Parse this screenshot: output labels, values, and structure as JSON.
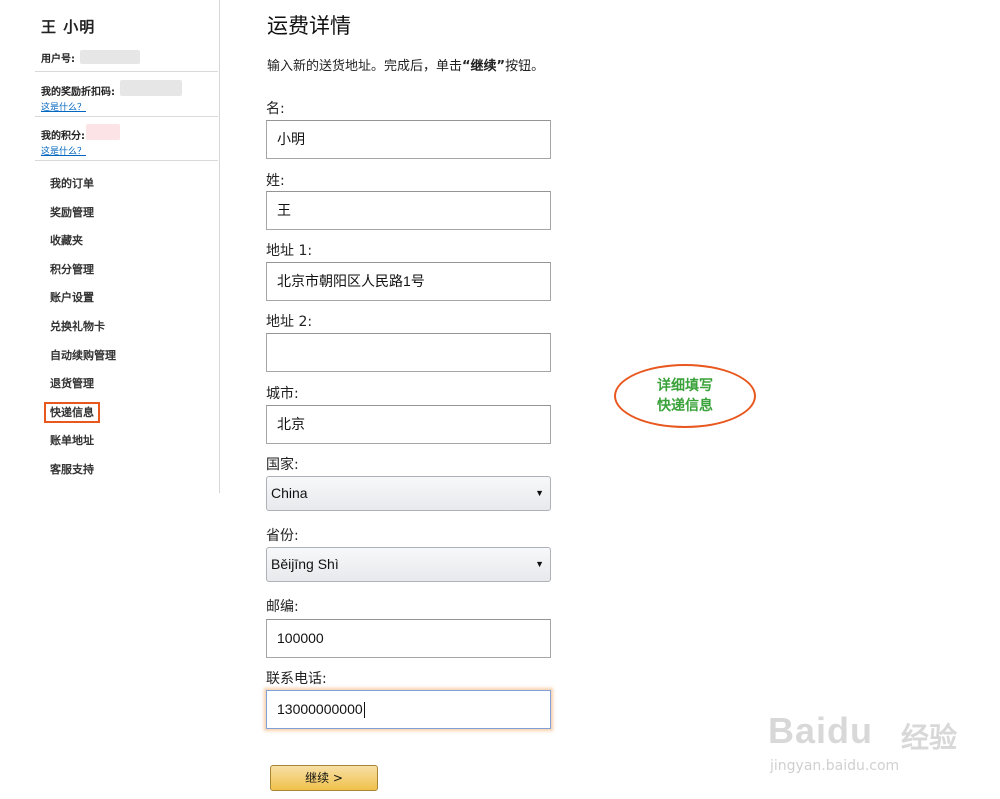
{
  "sidebar": {
    "user_name": "王 小明",
    "user_id_label": "用户号:",
    "reward_code_label": "我的奖励折扣码:",
    "reward_code_link": "这是什么？",
    "points_label": "我的积分:",
    "points_link": "这是什么？",
    "menu": [
      {
        "label": "我的订单"
      },
      {
        "label": "奖励管理"
      },
      {
        "label": "收藏夹"
      },
      {
        "label": "积分管理"
      },
      {
        "label": "账户设置"
      },
      {
        "label": "兑换礼物卡"
      },
      {
        "label": "自动续购管理"
      },
      {
        "label": "退货管理"
      },
      {
        "label": "快递信息",
        "active": true
      },
      {
        "label": "账单地址"
      },
      {
        "label": "客服支持"
      }
    ],
    "highlight_color": "#e8571e"
  },
  "form": {
    "title": "运费详情",
    "instruction_prefix": "输入新的送货地址。完成后，单击",
    "instruction_bold": "“继续”",
    "instruction_suffix": "按钮。",
    "first_name_label": "名:",
    "first_name_value": "小明",
    "last_name_label": "姓:",
    "last_name_value": "王",
    "address1_label": "地址 1:",
    "address1_value": "北京市朝阳区人民路1号",
    "address2_label": "地址 2:",
    "address2_value": "",
    "city_label": "城市:",
    "city_value": "北京",
    "country_label": "国家:",
    "country_value": "China",
    "province_label": "省份:",
    "province_value": "Běijīng Shì",
    "zip_label": "邮编:",
    "zip_value": "100000",
    "phone_label": "联系电话:",
    "phone_value": "13000000000",
    "continue_button": "继续 >"
  },
  "annotation": {
    "line1": "详细填写",
    "line2": "快递信息",
    "text_color": "#3aa23a",
    "border_color": "#e8571e"
  },
  "watermark": {
    "logo": "Baidu",
    "cn": "经验",
    "url": "jingyan.baidu.com"
  }
}
